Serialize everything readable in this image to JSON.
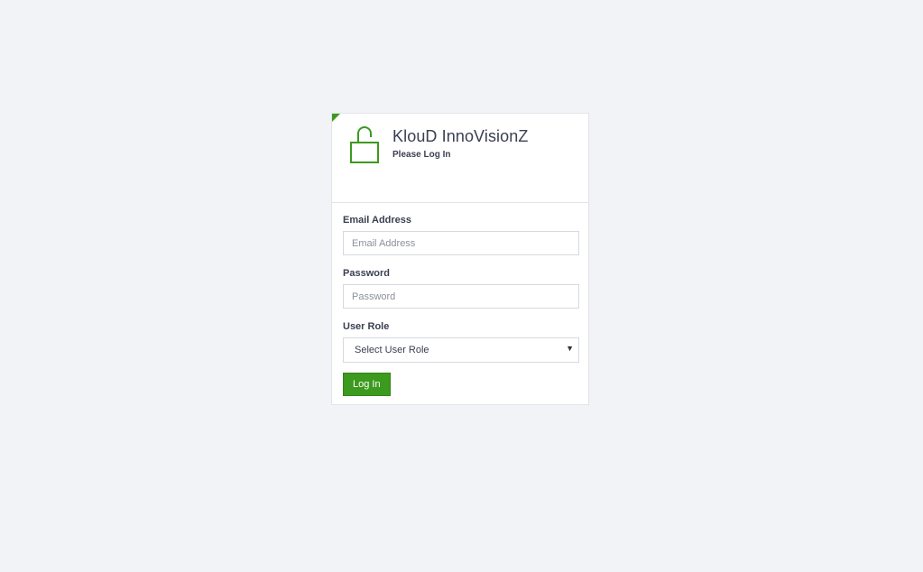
{
  "header": {
    "title": "KlouD InnoVisionZ",
    "subtitle": "Please Log In",
    "icon": "unlocked-padlock-icon",
    "accent_color": "#3c9a1e"
  },
  "form": {
    "email": {
      "label": "Email Address",
      "placeholder": "Email Address",
      "value": ""
    },
    "password": {
      "label": "Password",
      "placeholder": "Password",
      "value": ""
    },
    "role": {
      "label": "User Role",
      "selected": "Select User Role"
    },
    "submit_label": "Log In"
  }
}
